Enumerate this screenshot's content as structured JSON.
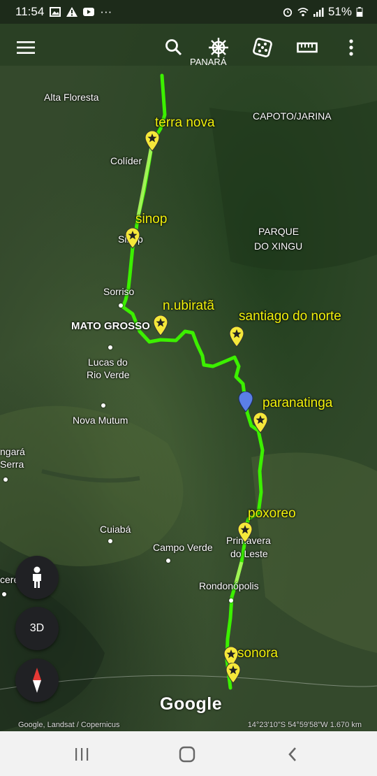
{
  "status_bar": {
    "time": "11:54",
    "overflow": "···",
    "battery": "51%",
    "left_icons": [
      "gallery-icon",
      "warning-icon",
      "youtube-icon"
    ],
    "right_icons": [
      "alarm-icon",
      "wifi-icon",
      "signal-icon",
      "battery-icon"
    ]
  },
  "toolbar": {
    "menu_icon": "hamburger-menu-icon",
    "search_icon": "search-icon",
    "voyager_icon": "ship-wheel-icon",
    "voyager_label": "PANARÁ",
    "feeling_lucky_icon": "dice-icon",
    "measure_icon": "ruler-icon",
    "more_icon": "more-vert-icon"
  },
  "map": {
    "places": {
      "alta_floresta": "Alta Floresta",
      "capoto_jarina": "CAPOTO/JARINA",
      "colider": "Colíder",
      "parque_1": "PARQUE",
      "parque_2": "DO XINGU",
      "sinop_city": "Sinop",
      "sorriso": "Sorriso",
      "mato_grosso": "MATO GROSSO",
      "lucas_1": "Lucas do",
      "lucas_2": "Rio Verde",
      "nova_mutum": "Nova Mutum",
      "tangara_1": "ngará",
      "tangara_2": "Serra",
      "cuiaba": "Cuiabá",
      "campo_verde": "Campo Verde",
      "primavera_1": "Primavera",
      "primavera_2": "do Leste",
      "rondonopolis": "Rondonópolis",
      "caceres": "cere"
    },
    "markers": {
      "terra_nova": "terra nova",
      "sinop": "sinop",
      "n_ubirata": "n.ubiratã",
      "santiago": "santiago do norte",
      "paranatinga": "paranatinga",
      "poxoreo": "poxoreo",
      "sonora": "sonora"
    },
    "route_color": "#3cf000",
    "marker_label_color": "#f2f20c"
  },
  "controls": {
    "pegman_icon": "pegman-icon",
    "view_3d": "3D",
    "compass_icon": "compass-icon"
  },
  "footer": {
    "logo": "Google",
    "attribution": "Google, Landsat / Copernicus",
    "coordinates": "14°23'10\"S 54°59'58\"W 1.670 km"
  },
  "nav_bar": {
    "recents_icon": "recents-icon",
    "home_icon": "home-icon",
    "back_icon": "back-icon"
  }
}
